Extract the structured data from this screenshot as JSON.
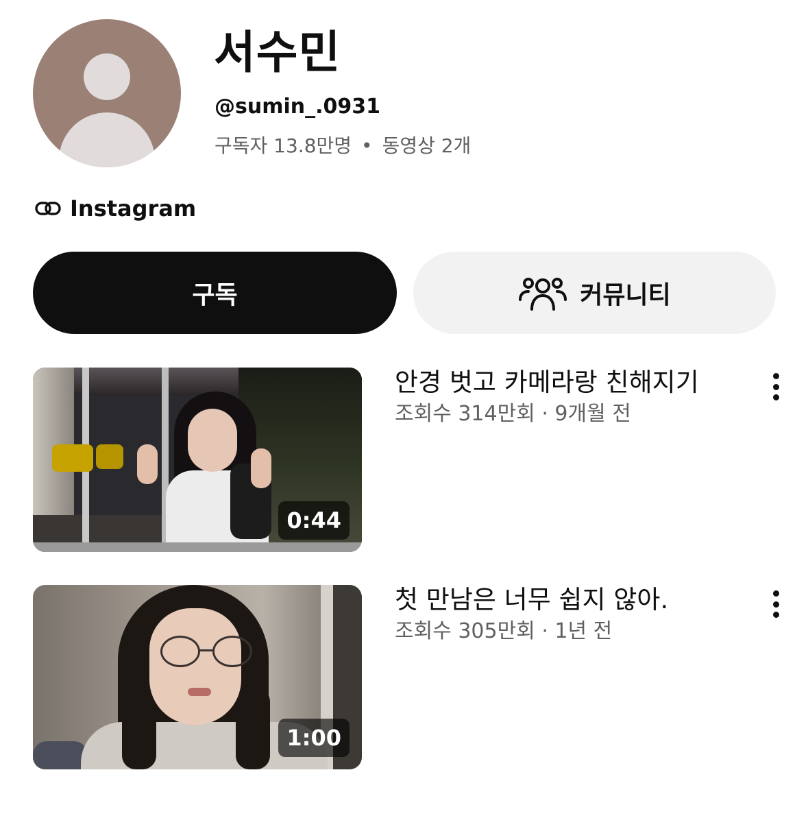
{
  "channel": {
    "name": "서수민",
    "handle": "@sumin_.0931",
    "subscribers": "구독자 13.8만명",
    "separator": "•",
    "videos": "동영상 2개",
    "avatar_color": "#9b8175"
  },
  "link": {
    "icon": "link-icon",
    "label": "Instagram"
  },
  "buttons": {
    "subscribe_label": "구독",
    "community_label": "커뮤니티",
    "community_icon": "people-icon"
  },
  "videos": [
    {
      "title": "안경 벗고 카메라랑 친해지기",
      "meta": "조회수 314만회 · 9개월 전",
      "duration": "0:44"
    },
    {
      "title": "첫 만남은 너무 쉽지 않아.",
      "meta": "조회수 305만회 · 1년 전",
      "duration": "1:00"
    }
  ]
}
